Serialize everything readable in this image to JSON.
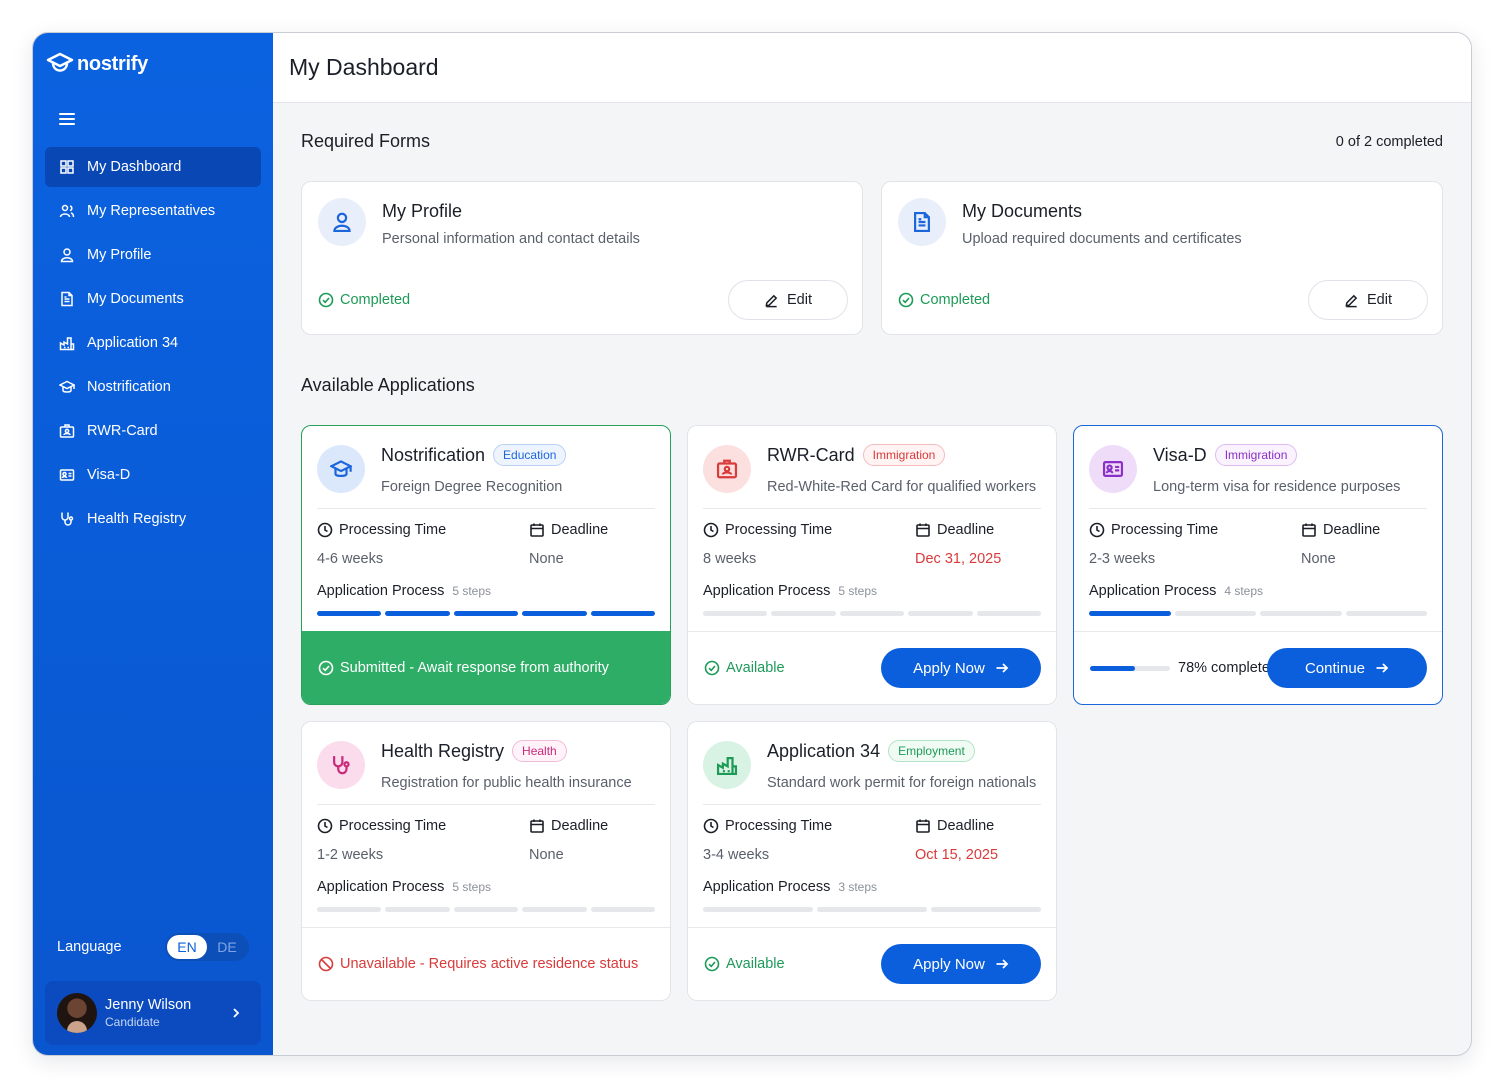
{
  "brand": {
    "name": "nostrify"
  },
  "page_title": "My Dashboard",
  "nav": [
    {
      "label": "My Dashboard",
      "icon": "grid-icon",
      "active": true
    },
    {
      "label": "My Representatives",
      "icon": "users-icon"
    },
    {
      "label": "My Profile",
      "icon": "user-icon"
    },
    {
      "label": "My Documents",
      "icon": "document-icon"
    },
    {
      "label": "Application 34",
      "icon": "factory-icon"
    },
    {
      "label": "Nostrification",
      "icon": "graduation-cap-icon"
    },
    {
      "label": "RWR-Card",
      "icon": "id-badge-icon"
    },
    {
      "label": "Visa-D",
      "icon": "id-card-icon"
    },
    {
      "label": "Health Registry",
      "icon": "stethoscope-icon"
    }
  ],
  "language": {
    "label": "Language",
    "options": [
      "EN",
      "DE"
    ],
    "selected": "EN"
  },
  "user": {
    "name": "Jenny Wilson",
    "role": "Candidate"
  },
  "required_forms": {
    "title": "Required Forms",
    "count_text": "0 of 2 completed",
    "items": [
      {
        "title": "My Profile",
        "description": "Personal information and contact details",
        "status": "Completed",
        "edit_label": "Edit",
        "icon": "user-icon"
      },
      {
        "title": "My Documents",
        "description": "Upload required documents and certificates",
        "status": "Completed",
        "edit_label": "Edit",
        "icon": "document-icon"
      }
    ]
  },
  "applications": {
    "title": "Available Applications",
    "processing_label": "Processing Time",
    "deadline_label": "Deadline",
    "process_label": "Application Process",
    "items": [
      {
        "title": "Nostrification",
        "badge": "Education",
        "description": "Foreign Degree Recognition",
        "processing_time": "4-6 weeks",
        "deadline": "None",
        "steps_text": "5 steps",
        "steps_total": 5,
        "steps_done": 5,
        "footer_status": "Submitted - Await response from authority",
        "footer_kind": "submitted",
        "icon": "graduation-cap-icon"
      },
      {
        "title": "RWR-Card",
        "badge": "Immigration",
        "description": "Red-White-Red Card for qualified workers",
        "processing_time": "8 weeks",
        "deadline": "Dec 31, 2025",
        "steps_text": "5 steps",
        "steps_total": 5,
        "steps_done": 0,
        "footer_status": "Available",
        "footer_kind": "available",
        "action_label": "Apply Now",
        "icon": "id-badge-icon"
      },
      {
        "title": "Visa-D",
        "badge": "Immigration",
        "description": "Long-term visa for residence purposes",
        "processing_time": "2-3 weeks",
        "deadline": "None",
        "steps_text": "4 steps",
        "steps_total": 4,
        "steps_done": 1,
        "progress_percent": 78,
        "progress_text": "78% complete",
        "footer_kind": "progress",
        "action_label": "Continue",
        "icon": "id-card-icon"
      },
      {
        "title": "Health Registry",
        "badge": "Health",
        "description": "Registration for public health insurance",
        "processing_time": "1-2 weeks",
        "deadline": "None",
        "steps_text": "5 steps",
        "steps_total": 5,
        "steps_done": 0,
        "footer_status": "Unavailable - Requires active residence status",
        "footer_kind": "unavailable",
        "icon": "stethoscope-icon"
      },
      {
        "title": "Application 34",
        "badge": "Employment",
        "description": "Standard work permit for foreign nationals",
        "processing_time": "3-4 weeks",
        "deadline": "Oct 15, 2025",
        "steps_text": "3 steps",
        "steps_total": 3,
        "steps_done": 0,
        "footer_status": "Available",
        "footer_kind": "available",
        "action_label": "Apply Now",
        "icon": "factory-icon"
      }
    ]
  },
  "colors": {
    "primary": "#0b5fdc",
    "success": "#2ead66",
    "danger": "#d93a3a"
  }
}
